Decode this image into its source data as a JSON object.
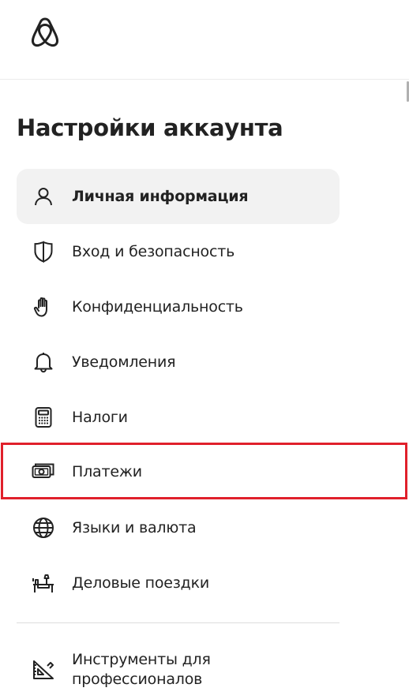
{
  "header": {
    "logo_icon": "airbnb-logo-icon"
  },
  "page": {
    "title": "Настройки аккаунта"
  },
  "menu": {
    "items": [
      {
        "label": "Личная информация",
        "icon": "person-icon",
        "active": true
      },
      {
        "label": "Вход и безопасность",
        "icon": "shield-icon",
        "active": false
      },
      {
        "label": "Конфиденциальность",
        "icon": "hand-icon",
        "active": false
      },
      {
        "label": "Уведомления",
        "icon": "bell-icon",
        "active": false
      },
      {
        "label": "Налоги",
        "icon": "calculator-icon",
        "active": false
      },
      {
        "label": "Платежи",
        "icon": "cash-icon",
        "active": false
      },
      {
        "label": "Языки и валюта",
        "icon": "globe-icon",
        "active": false
      },
      {
        "label": "Деловые поездки",
        "icon": "desk-icon",
        "active": false
      },
      {
        "label": "Инструменты для профессионалов",
        "icon": "ruler-triangle-icon",
        "active": false
      }
    ]
  },
  "colors": {
    "text": "#222222",
    "active_bg": "#f2f2f2",
    "highlight_border": "#e0202b",
    "divider": "#dddddd"
  }
}
